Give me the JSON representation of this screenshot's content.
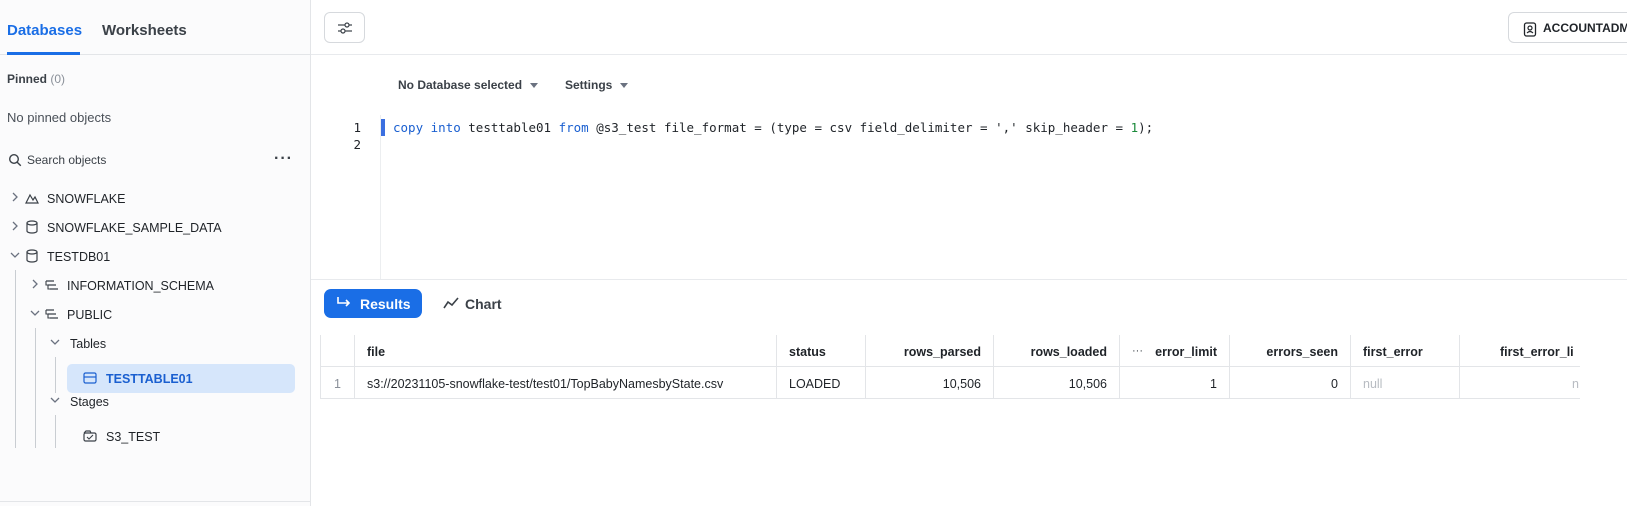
{
  "sidebar": {
    "tabs": [
      "Databases",
      "Worksheets"
    ],
    "pinned_label": "Pinned",
    "pinned_count": "(0)",
    "no_pinned": "No pinned objects",
    "search_placeholder": "Search objects",
    "tree": {
      "snowflake": "SNOWFLAKE",
      "sample_data": "SNOWFLAKE_SAMPLE_DATA",
      "testdb": "TESTDB01",
      "information_schema": "INFORMATION_SCHEMA",
      "public": "PUBLIC",
      "tables": "Tables",
      "testtable": "TESTTABLE01",
      "stages": "Stages",
      "s3_test": "S3_TEST"
    }
  },
  "topbar": {
    "role": "ACCOUNTADMI"
  },
  "context": {
    "database": "No Database selected",
    "settings": "Settings"
  },
  "editor": {
    "line_numbers": [
      "1",
      "2"
    ]
  },
  "results_tabs": {
    "results": "Results",
    "chart": "Chart"
  },
  "results": {
    "columns": [
      "file",
      "status",
      "rows_parsed",
      "rows_loaded",
      "error_limit",
      "errors_seen",
      "first_error",
      "first_error_li"
    ],
    "rows": [
      {
        "num": "1",
        "file": "s3://20231105-snowflake-test/test01/TopBabyNamesbyState.csv",
        "status": "LOADED",
        "rows_parsed": "10,506",
        "rows_loaded": "10,506",
        "error_limit": "1",
        "errors_seen": "0",
        "first_error": "null",
        "first_error_li": "n"
      }
    ]
  },
  "colors": {
    "accent": "#1a6ee6",
    "selected_bg": "#d6e6fb",
    "keyword": "#1a5fd0"
  }
}
